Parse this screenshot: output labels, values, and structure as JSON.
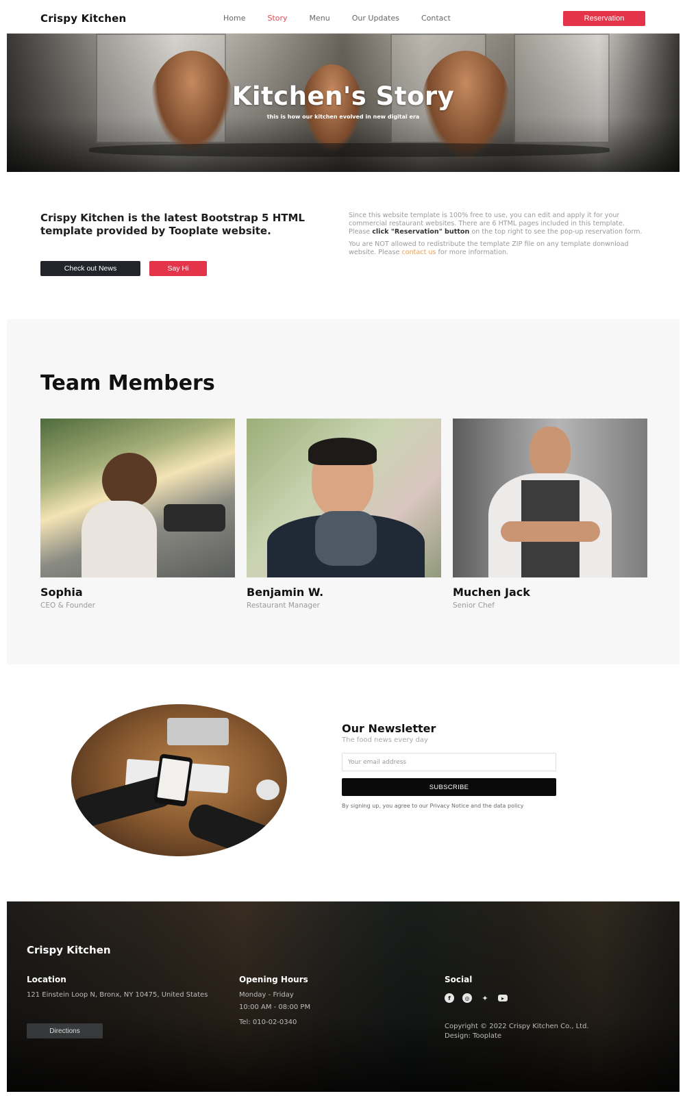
{
  "nav": {
    "brand": "Crispy Kitchen",
    "links": [
      "Home",
      "Story",
      "Menu",
      "Our Updates",
      "Contact"
    ],
    "active": "Story",
    "reservation": "Reservation"
  },
  "hero": {
    "title": "Kitchen's Story",
    "subtitle": "this is how our kitchen evolved in new digital era"
  },
  "intro": {
    "heading": "Crispy Kitchen is the latest Bootstrap 5 HTML template provided by Tooplate website.",
    "btn_news": "Check out News",
    "btn_hi": "Say Hi",
    "p1_a": "Since this website template is 100% free to use, you can edit and apply it for your commercial restaurant websites. There are 6 HTML pages included in this template. Please ",
    "p1_bold": "click \"Reservation\" button",
    "p1_b": " on the top right to see the pop-up reservation form.",
    "p2_a": "You are NOT allowed to redistribute the template ZIP file on any template donwnload website. Please ",
    "p2_link": "contact us",
    "p2_b": " for more information."
  },
  "team": {
    "title": "Team Members",
    "members": [
      {
        "name": "Sophia",
        "role": "CEO & Founder"
      },
      {
        "name": "Benjamin W.",
        "role": "Restaurant Manager"
      },
      {
        "name": "Muchen Jack",
        "role": "Senior Chef"
      }
    ]
  },
  "newsletter": {
    "title": "Our Newsletter",
    "subtitle": "The food news every day",
    "placeholder": "Your email address",
    "button": "SUBSCRIBE",
    "note": "By signing up, you agree to our Privacy Notice and the data policy"
  },
  "footer": {
    "brand": "Crispy Kitchen",
    "location_h": "Location",
    "address": "121 Einstein Loop N, Bronx, NY 10475, United States",
    "directions": "Directions",
    "hours_h": "Opening Hours",
    "days": "Monday - Friday",
    "hours": "10:00 AM - 08:00 PM",
    "tel": "Tel: 010-02-0340",
    "social_h": "Social",
    "social_icons": [
      "facebook-icon",
      "instagram-icon",
      "twitter-icon",
      "youtube-icon"
    ],
    "copyright": "Copyright © 2022 Crispy Kitchen Co., Ltd.",
    "design": "Design: Tooplate"
  },
  "colors": {
    "accent": "#e3344a",
    "dark": "#212529"
  }
}
